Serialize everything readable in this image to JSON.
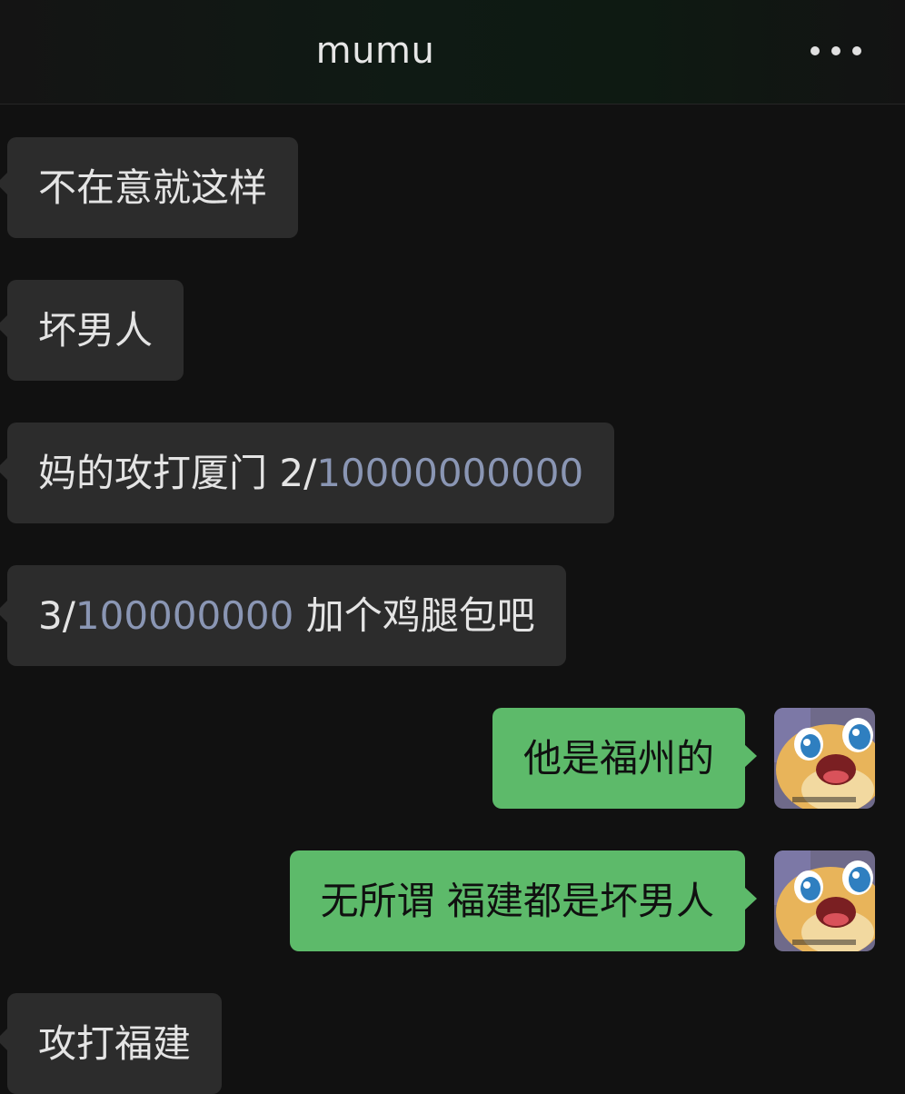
{
  "header": {
    "title": "mumu",
    "more_icon": "more-dots-icon"
  },
  "messages": [
    {
      "direction": "incoming",
      "text": "不在意就这样"
    },
    {
      "direction": "incoming",
      "text": "坏男人"
    },
    {
      "direction": "incoming",
      "prefix": "妈的攻打厦门 2/",
      "link": "10000000000",
      "suffix": ""
    },
    {
      "direction": "incoming",
      "prefix": "3/",
      "link": "100000000",
      "suffix": " 加个鸡腿包吧"
    },
    {
      "direction": "outgoing",
      "text": "他是福州的",
      "avatar": "cartoon-avatar"
    },
    {
      "direction": "outgoing",
      "text": "无所谓 福建都是坏男人",
      "avatar": "cartoon-avatar"
    },
    {
      "direction": "incoming",
      "text": "攻打福建"
    }
  ],
  "colors": {
    "background": "#111111",
    "incoming_bubble": "#2c2c2c",
    "outgoing_bubble": "#5dba6a",
    "link_number": "#8a96b4"
  }
}
